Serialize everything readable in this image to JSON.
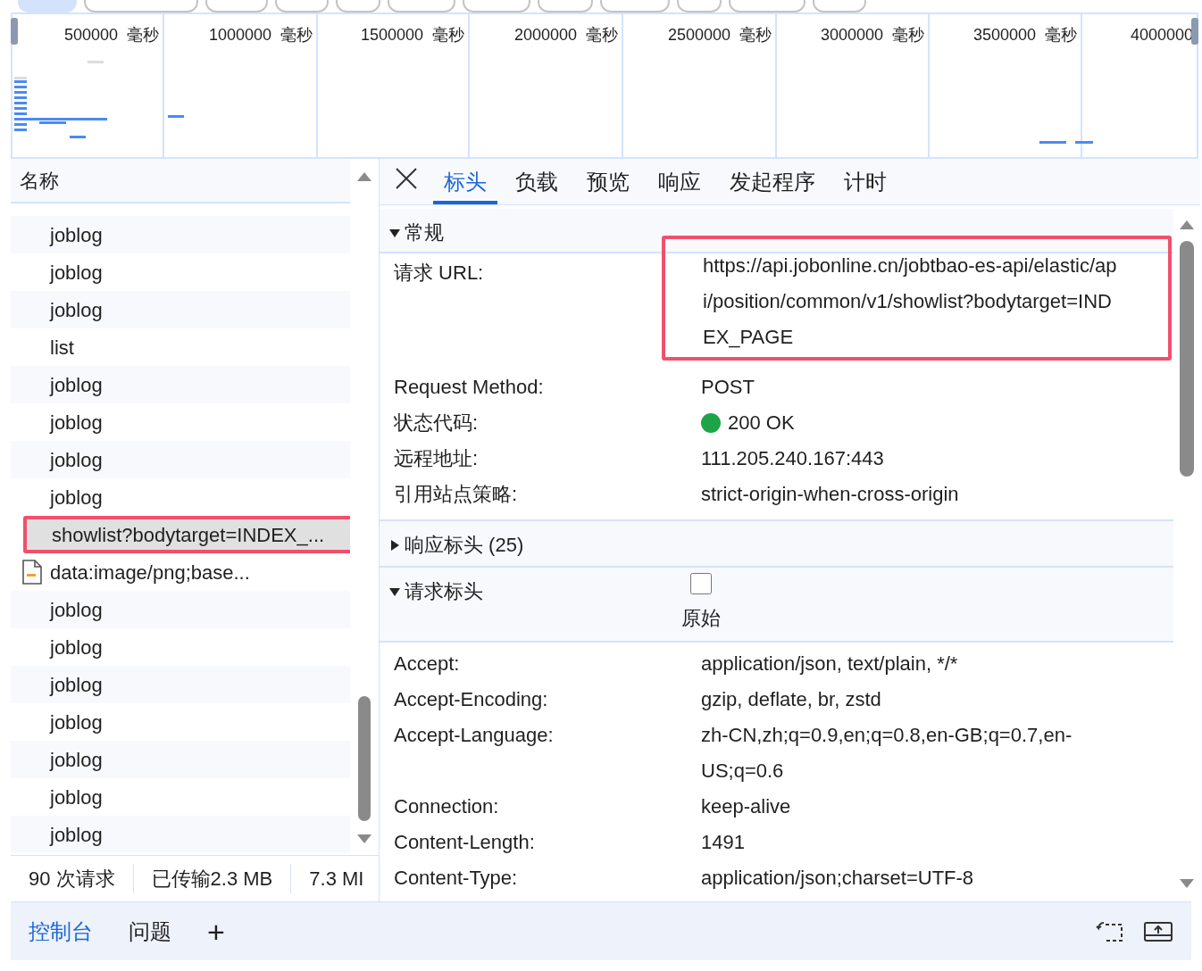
{
  "filter_chips": [
    {
      "selected": true
    },
    {
      "selected": false
    },
    {
      "selected": false
    },
    {
      "selected": false
    },
    {
      "selected": false
    },
    {
      "selected": false
    },
    {
      "selected": false
    },
    {
      "selected": false
    },
    {
      "selected": false
    },
    {
      "selected": false
    },
    {
      "selected": false
    },
    {
      "selected": false
    }
  ],
  "timeline": {
    "ticks": [
      "500000  毫秒",
      "1000000  毫秒",
      "1500000  毫秒",
      "2000000  毫秒",
      "2500000  毫秒",
      "3000000  毫秒",
      "3500000  毫秒",
      "4000000"
    ]
  },
  "requests": {
    "header": "名称",
    "rows": [
      {
        "name": "joblog",
        "kind": "plain",
        "selected": false
      },
      {
        "name": "joblog",
        "kind": "plain",
        "selected": false
      },
      {
        "name": "joblog",
        "kind": "plain",
        "selected": false
      },
      {
        "name": "list",
        "kind": "plain",
        "selected": false
      },
      {
        "name": "joblog",
        "kind": "plain",
        "selected": false
      },
      {
        "name": "joblog",
        "kind": "plain",
        "selected": false
      },
      {
        "name": "joblog",
        "kind": "plain",
        "selected": false
      },
      {
        "name": "joblog",
        "kind": "plain",
        "selected": false
      },
      {
        "name": "showlist?bodytarget=INDEX_...",
        "kind": "plain",
        "selected": true,
        "highlighted": true
      },
      {
        "name": "data:image/png;base...",
        "kind": "image",
        "selected": false
      },
      {
        "name": "joblog",
        "kind": "plain",
        "selected": false
      },
      {
        "name": "joblog",
        "kind": "plain",
        "selected": false
      },
      {
        "name": "joblog",
        "kind": "plain",
        "selected": false
      },
      {
        "name": "joblog",
        "kind": "plain",
        "selected": false
      },
      {
        "name": "joblog",
        "kind": "plain",
        "selected": false
      },
      {
        "name": "joblog",
        "kind": "plain",
        "selected": false
      },
      {
        "name": "joblog",
        "kind": "plain",
        "selected": false
      }
    ]
  },
  "status_bar": [
    "90 次请求",
    "已传输2.3 MB",
    "7.3 MI"
  ],
  "detail_tabs": [
    {
      "label": "标头",
      "selected": true
    },
    {
      "label": "负载",
      "selected": false
    },
    {
      "label": "预览",
      "selected": false
    },
    {
      "label": "响应",
      "selected": false
    },
    {
      "label": "发起程序",
      "selected": false
    },
    {
      "label": "计时",
      "selected": false
    }
  ],
  "general": {
    "title": "常规",
    "expanded": true,
    "rows": [
      {
        "kind": "url",
        "label": "请求 URL:",
        "lines": [
          "https://api.jobonline.cn/jobtbao-es-api/elastic/ap",
          "i/position/common/v1/showlist?bodytarget=IND",
          "EX_PAGE"
        ],
        "highlighted": true
      },
      {
        "kind": "text",
        "label": "Request Method:",
        "value": "POST"
      },
      {
        "kind": "status",
        "label": "状态代码:",
        "value": "200 OK",
        "color": "#1ea446"
      },
      {
        "kind": "text",
        "label": "远程地址:",
        "value": "111.205.240.167:443"
      },
      {
        "kind": "text",
        "label": "引用站点策略:",
        "value": "strict-origin-when-cross-origin"
      }
    ]
  },
  "response_headers": {
    "title": "响应标头 (25)",
    "expanded": false
  },
  "request_headers": {
    "title": "请求标头",
    "expanded": true,
    "raw_label": "原始",
    "raw_checked": false,
    "rows": [
      {
        "label": "Accept:",
        "lines": [
          "application/json, text/plain, */*"
        ]
      },
      {
        "label": "Accept-Encoding:",
        "lines": [
          "gzip, deflate, br, zstd"
        ]
      },
      {
        "label": "Accept-Language:",
        "lines": [
          "zh-CN,zh;q=0.9,en;q=0.8,en-GB;q=0.7,en-",
          "US;q=0.6"
        ]
      },
      {
        "label": "Connection:",
        "lines": [
          "keep-alive"
        ]
      },
      {
        "label": "Content-Length:",
        "lines": [
          "1491"
        ]
      },
      {
        "label": "Content-Type:",
        "lines": [
          "application/json;charset=UTF-8"
        ]
      }
    ]
  },
  "drawer_tabs": [
    {
      "label": "控制台",
      "selected": true
    },
    {
      "label": "问题",
      "selected": false
    },
    {
      "label": "+",
      "selected": false
    }
  ]
}
